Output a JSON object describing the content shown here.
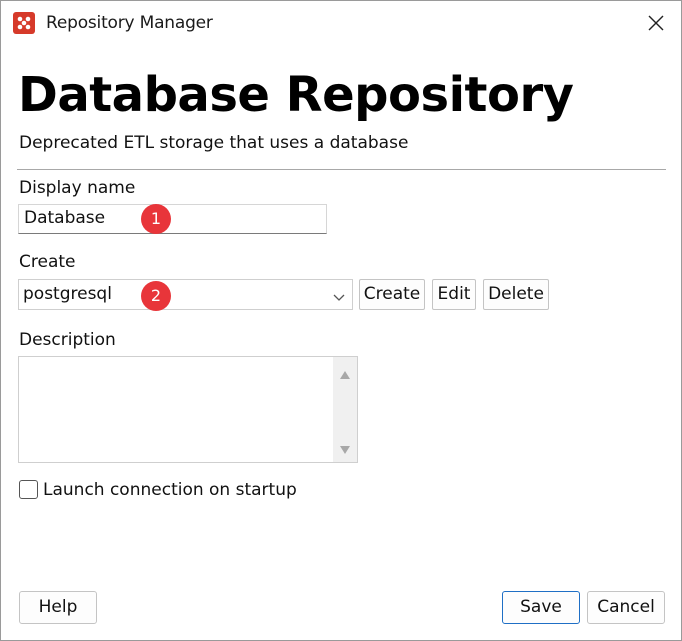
{
  "window": {
    "title": "Repository Manager",
    "accent_color": "#1f6fc5",
    "icon": "repository-app-icon"
  },
  "header": {
    "title": "Database Repository",
    "subtitle": "Deprecated ETL storage that uses a database"
  },
  "display_name": {
    "label": "Display name",
    "value": "Database",
    "badge": "1"
  },
  "create": {
    "label": "Create",
    "selected": "postgresql",
    "badge": "2",
    "buttons": {
      "create": "Create",
      "edit": "Edit",
      "delete": "Delete"
    }
  },
  "description": {
    "label": "Description",
    "value": ""
  },
  "launch_option": {
    "label": "Launch connection on startup",
    "checked": false
  },
  "footer": {
    "help": "Help",
    "save": "Save",
    "cancel": "Cancel"
  },
  "badge_color": "#e8353a"
}
